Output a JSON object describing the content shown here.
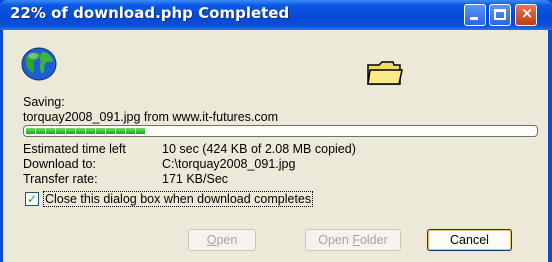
{
  "window": {
    "title": "22% of download.php Completed"
  },
  "icons": {
    "globe": "globe-icon",
    "folder": "folder-icon",
    "check": "✓",
    "close": "×"
  },
  "saving_label": "Saving:",
  "file_source": "torquay2008_091.jpg from www.it-futures.com",
  "progress": {
    "percent": 22,
    "segments": 12
  },
  "details": {
    "time_label": "Estimated time left",
    "time_value": "10 sec (424 KB of 2.08 MB copied)",
    "download_label": "Download to:",
    "download_value": "C:\\torquay2008_091.jpg",
    "rate_label": "Transfer rate:",
    "rate_value": "171 KB/Sec"
  },
  "checkbox": {
    "checked": true,
    "label": "Close this dialog box when download completes"
  },
  "buttons": {
    "open_first": "O",
    "open_rest": "pen",
    "open_folder_first": "Open ",
    "open_folder_ul": "F",
    "open_folder_rest": "older",
    "cancel": "Cancel"
  },
  "colors": {
    "titlebar": "#0648d6",
    "client": "#ece9d8",
    "progress": "#1fa51f"
  }
}
